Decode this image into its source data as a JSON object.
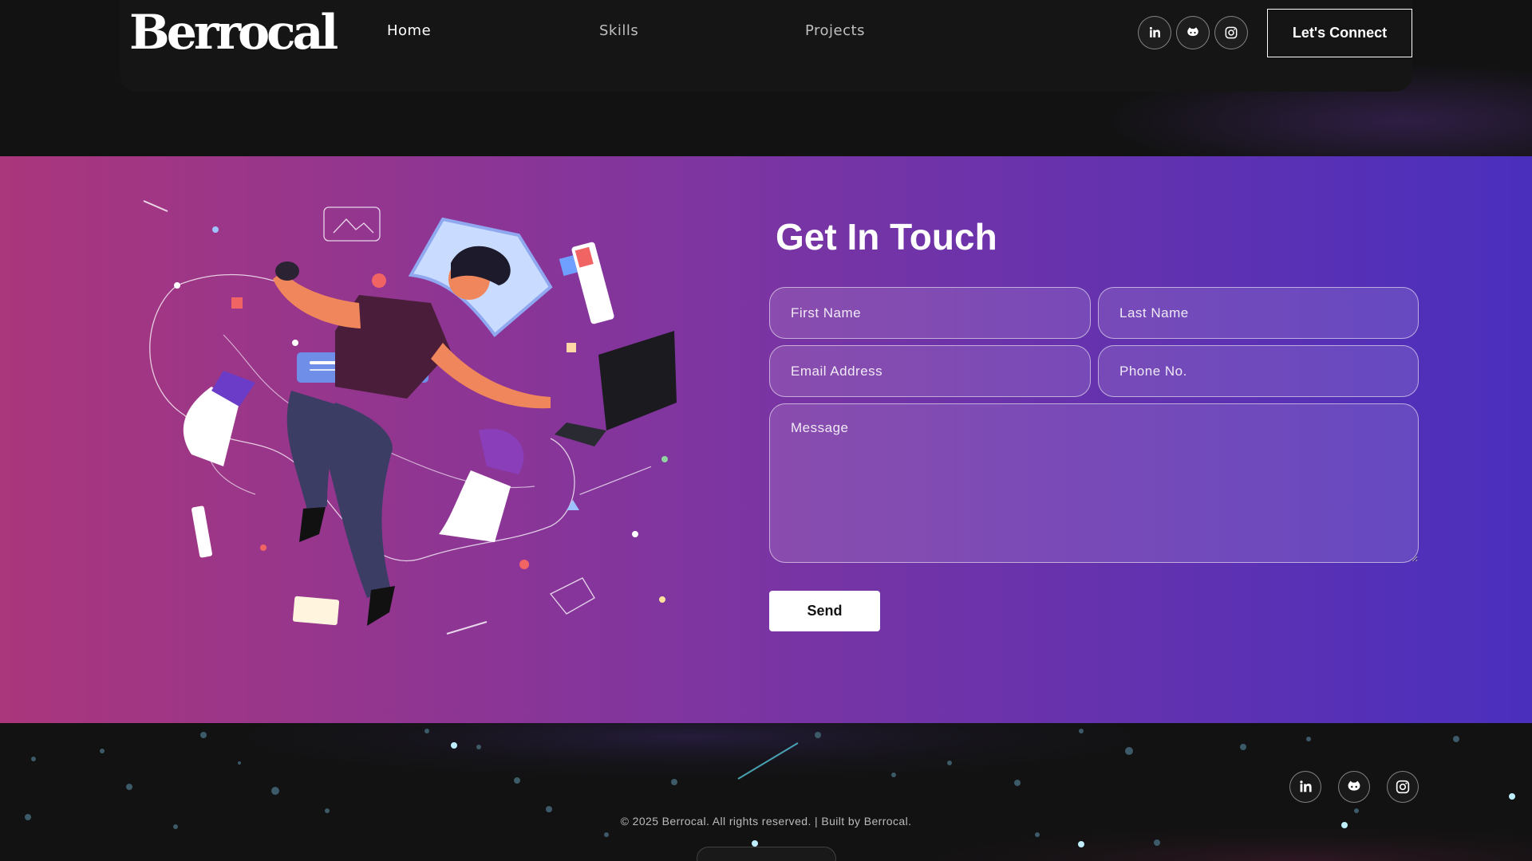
{
  "brand": {
    "logo_text": "Berrocal"
  },
  "nav": {
    "links": [
      {
        "label": "Home"
      },
      {
        "label": "Skills"
      },
      {
        "label": "Projects"
      }
    ],
    "social": [
      {
        "icon": "linkedin-icon"
      },
      {
        "icon": "github-icon"
      },
      {
        "icon": "instagram-icon"
      }
    ],
    "connect_label": "Let's Connect"
  },
  "contact": {
    "title": "Get In Touch",
    "fields": {
      "first_name": {
        "placeholder": "First Name",
        "value": ""
      },
      "last_name": {
        "placeholder": "Last Name",
        "value": ""
      },
      "email": {
        "placeholder": "Email Address",
        "value": ""
      },
      "phone": {
        "placeholder": "Phone No.",
        "value": ""
      },
      "message": {
        "placeholder": "Message",
        "value": ""
      }
    },
    "send_label": "Send"
  },
  "footer": {
    "copyright": "© 2025 Berrocal. All rights reserved. | Built by Berrocal.",
    "social": [
      {
        "icon": "linkedin-icon"
      },
      {
        "icon": "github-icon"
      },
      {
        "icon": "instagram-icon"
      }
    ]
  },
  "colors": {
    "background": "#121212",
    "gradient_start": "#aa367c",
    "gradient_end": "#4a2fbd",
    "text": "#ffffff"
  }
}
